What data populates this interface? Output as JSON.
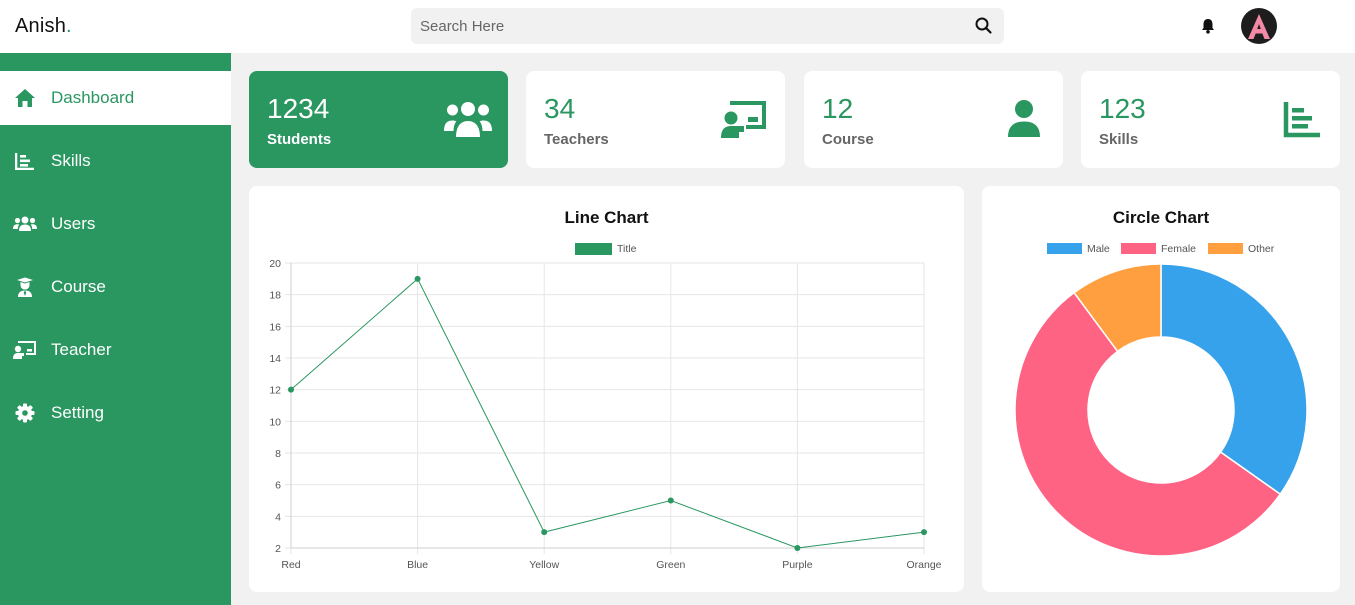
{
  "header": {
    "brand": "Anish",
    "brand_dot": ".",
    "search_placeholder": "Search Here"
  },
  "sidebar": {
    "items": [
      {
        "label": "Dashboard",
        "icon": "home-icon",
        "active": true
      },
      {
        "label": "Skills",
        "icon": "chart-bar-icon"
      },
      {
        "label": "Users",
        "icon": "users-icon"
      },
      {
        "label": "Course",
        "icon": "graduate-icon"
      },
      {
        "label": "Teacher",
        "icon": "chalkboard-teacher-icon"
      },
      {
        "label": "Setting",
        "icon": "gear-icon"
      }
    ]
  },
  "stats": [
    {
      "value": "1234",
      "label": "Students",
      "icon": "users-icon"
    },
    {
      "value": "34",
      "label": "Teachers",
      "icon": "chalkboard-teacher-icon"
    },
    {
      "value": "12",
      "label": "Course",
      "icon": "user-icon"
    },
    {
      "value": "123",
      "label": "Skills",
      "icon": "chart-bar-icon"
    }
  ],
  "colors": {
    "accent": "#2a9660",
    "male": "#36a2eb",
    "female": "#ff6384",
    "other": "#ff9f40"
  },
  "chart_data": [
    {
      "type": "line",
      "title": "Line Chart",
      "categories": [
        "Red",
        "Blue",
        "Yellow",
        "Green",
        "Purple",
        "Orange"
      ],
      "series": [
        {
          "name": "Title",
          "values": [
            12,
            19,
            3,
            5,
            2,
            3
          ]
        }
      ],
      "ylim": [
        2,
        20
      ],
      "yticks": [
        2,
        4,
        6,
        8,
        10,
        12,
        14,
        16,
        18,
        20
      ],
      "legend": "top",
      "grid": true
    },
    {
      "type": "pie",
      "title": "Circle Chart",
      "categories": [
        "Male",
        "Female",
        "Other"
      ],
      "values": [
        12,
        19,
        3.5
      ],
      "doughnut": true,
      "legend": "top"
    }
  ]
}
